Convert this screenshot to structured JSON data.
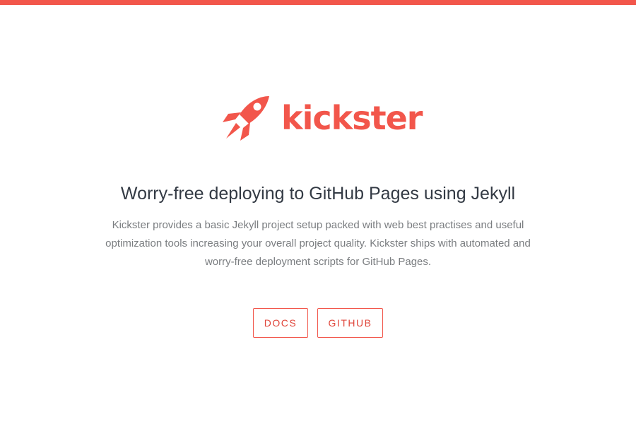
{
  "brand": {
    "name": "kickster",
    "accent_color": "#f2564b",
    "logo_icon": "rocket-icon"
  },
  "hero": {
    "headline": "Worry-free deploying to GitHub Pages using Jekyll",
    "description": "Kickster provides a basic Jekyll project setup packed with web best practises and useful optimization tools increasing your overall project quality. Kickster ships with automated and worry-free deployment scripts for GitHub Pages."
  },
  "actions": {
    "docs_label": "DOCS",
    "github_label": "GITHUB"
  }
}
